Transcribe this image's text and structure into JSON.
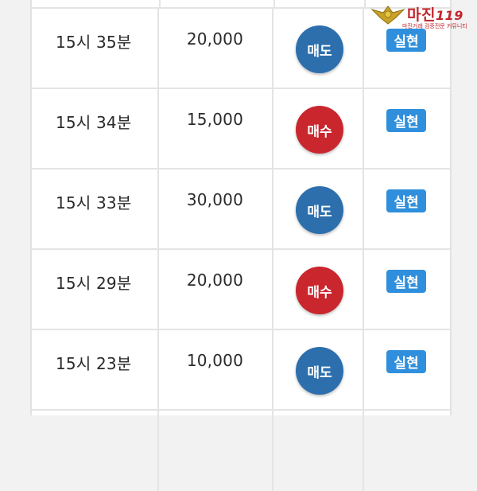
{
  "watermark": {
    "title": "마진",
    "suffix": "119",
    "subtitle": "마진거래 검증전문 커뮤니티"
  },
  "rows": [
    {
      "time": "15시 35분",
      "amount": "20,000",
      "type": "매도",
      "status": "실현"
    },
    {
      "time": "15시 34분",
      "amount": "15,000",
      "type": "매수",
      "status": "실현"
    },
    {
      "time": "15시 33분",
      "amount": "30,000",
      "type": "매도",
      "status": "실현"
    },
    {
      "time": "15시 29분",
      "amount": "20,000",
      "type": "매수",
      "status": "실현"
    },
    {
      "time": "15시 23분",
      "amount": "10,000",
      "type": "매도",
      "status": "실현"
    }
  ],
  "colors": {
    "sell": "#2d6fad",
    "buy": "#c9262d",
    "badge": "#2f8fdc"
  }
}
